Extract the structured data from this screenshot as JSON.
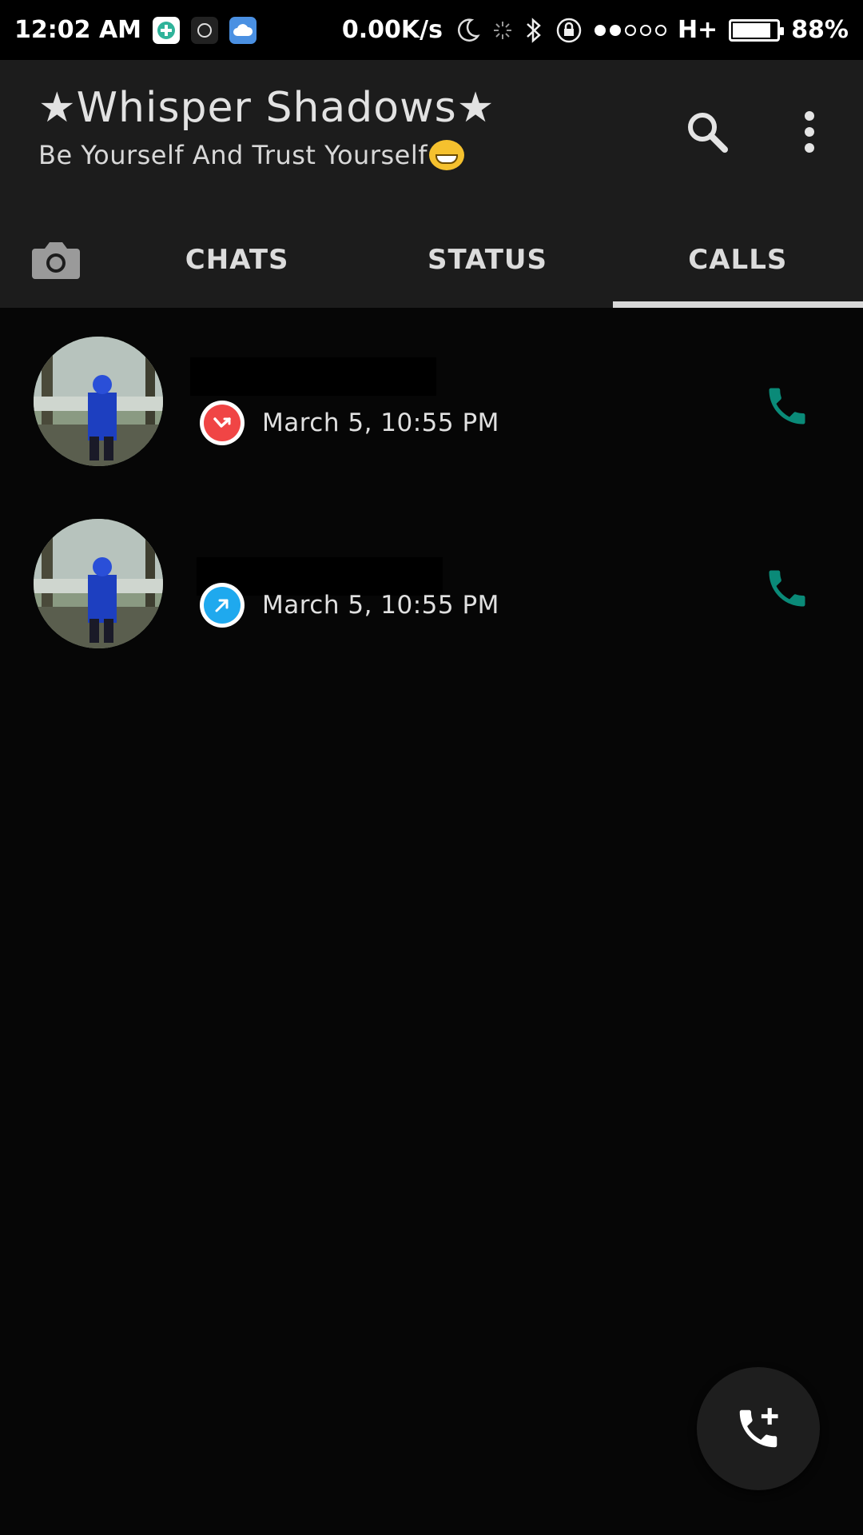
{
  "status_bar": {
    "time": "12:02 AM",
    "net_speed": "0.00K/s",
    "network_type": "H+",
    "battery_percent": "88%",
    "battery_level": 0.88,
    "signal_bars_on": 2,
    "signal_bars_total": 5
  },
  "header": {
    "title": "★Whisper Shadows★",
    "subtitle": "Be Yourself And Trust Yourself"
  },
  "tabs": [
    {
      "label": "CHATS",
      "active": false
    },
    {
      "label": "STATUS",
      "active": false
    },
    {
      "label": "CALLS",
      "active": true
    }
  ],
  "calls": [
    {
      "name": "",
      "direction": "missed",
      "time": "March 5, 10:55 PM"
    },
    {
      "name": "",
      "direction": "outgoing",
      "time": "March 5, 10:55 PM"
    }
  ],
  "colors": {
    "accent_teal": "#0a8a78",
    "missed_red": "#f04545",
    "outgoing_blue": "#1fa9ee",
    "header_bg": "#1c1c1c",
    "list_bg": "#060606"
  },
  "icons": {
    "camera": "camera-icon",
    "search": "search-icon",
    "more": "more-vert-icon",
    "call": "phone-icon",
    "fab": "add-call-icon"
  }
}
